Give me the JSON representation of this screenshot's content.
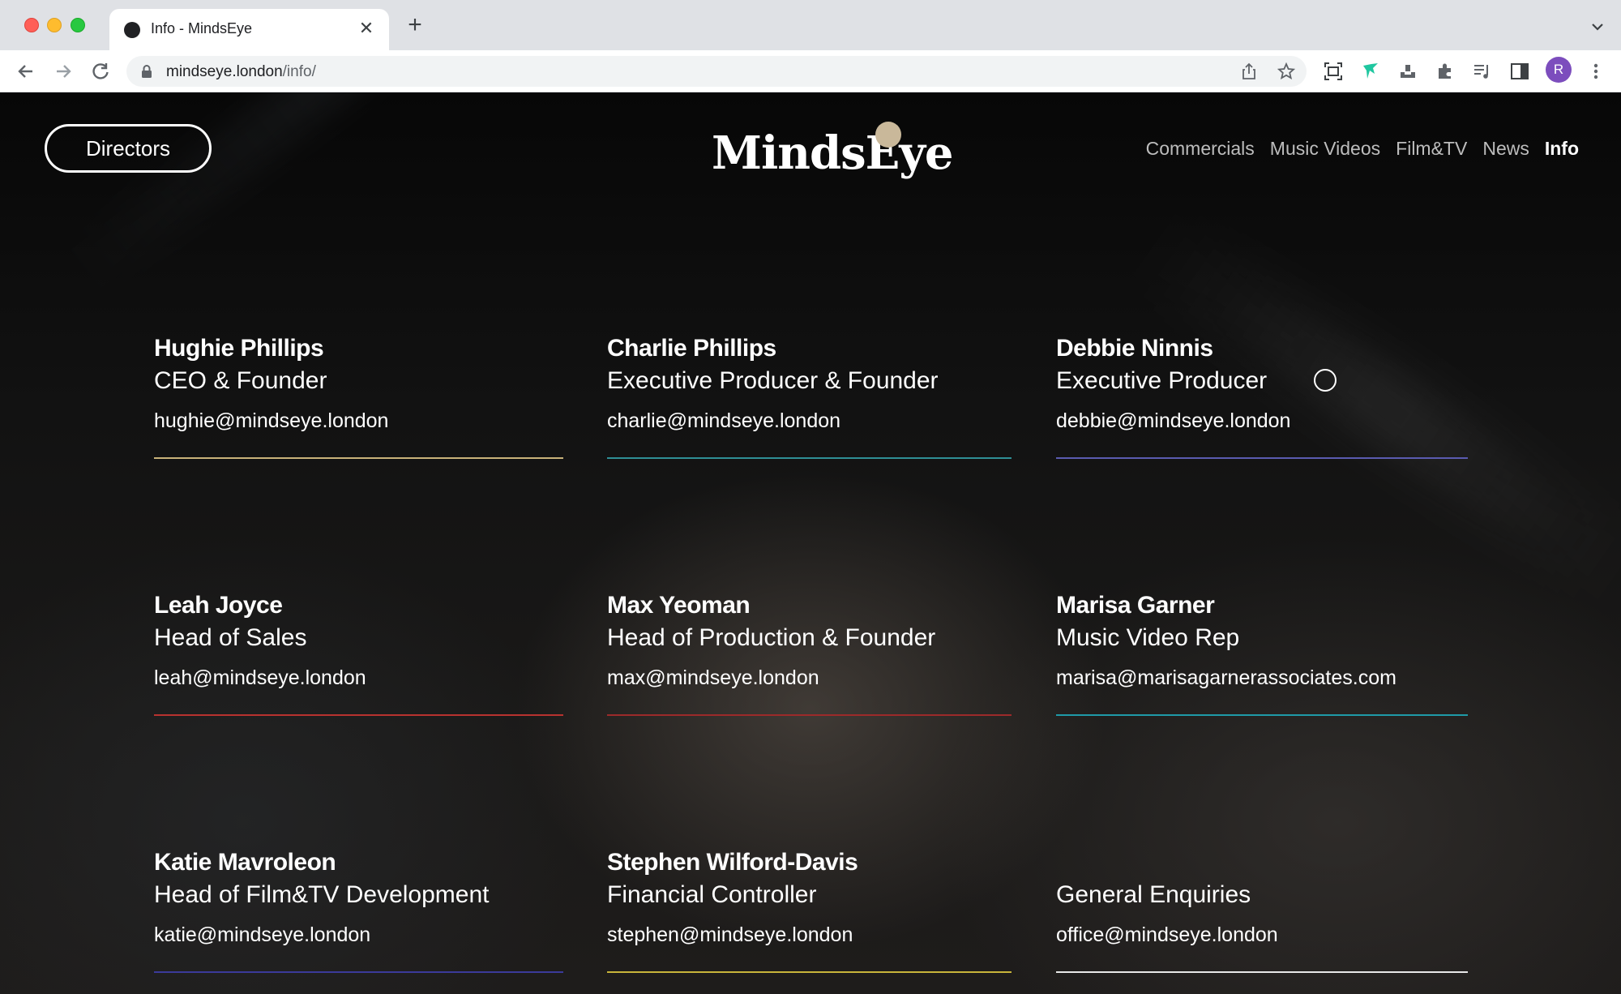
{
  "browser": {
    "tab_title": "Info - MindsEye",
    "url_domain": "mindseye.london",
    "url_path": "/info/",
    "avatar_letter": "R"
  },
  "site": {
    "directors_label": "Directors",
    "logo": "MindsEye",
    "nav": [
      {
        "label": "Commercials",
        "active": false
      },
      {
        "label": "Music Videos",
        "active": false
      },
      {
        "label": "Film&TV",
        "active": false
      },
      {
        "label": "News",
        "active": false
      },
      {
        "label": "Info",
        "active": true
      }
    ]
  },
  "contacts": [
    {
      "name": "Hughie Phillips",
      "role": "CEO & Founder",
      "email": "hughie@mindseye.london",
      "color": "#c9b27a"
    },
    {
      "name": "Charlie Phillips",
      "role": "Executive Producer & Founder",
      "email": "charlie@mindseye.london",
      "color": "#2f8f96"
    },
    {
      "name": "Debbie Ninnis",
      "role": "Executive Producer",
      "email": "debbie@mindseye.london",
      "color": "#5a5bb0"
    },
    {
      "name": "Leah Joyce",
      "role": "Head of Sales",
      "email": "leah@mindseye.london",
      "color": "#b8322f"
    },
    {
      "name": "Max Yeoman",
      "role": "Head of Production & Founder",
      "email": "max@mindseye.london",
      "color": "#9c2a2a"
    },
    {
      "name": "Marisa Garner",
      "role": "Music Video Rep",
      "email": "marisa@marisagarnerassociates.com",
      "color": "#1f9aa8"
    },
    {
      "name": "Katie Mavroleon",
      "role": "Head of Film&TV Development",
      "email": "katie@mindseye.london",
      "color": "#3b3a9a"
    },
    {
      "name": "Stephen Wilford-Davis",
      "role": "Financial Controller",
      "email": "stephen@mindseye.london",
      "color": "#c8b43a"
    },
    {
      "name": "",
      "role": "General Enquiries",
      "email": "office@mindseye.london",
      "color": "#e8e8e8"
    }
  ]
}
